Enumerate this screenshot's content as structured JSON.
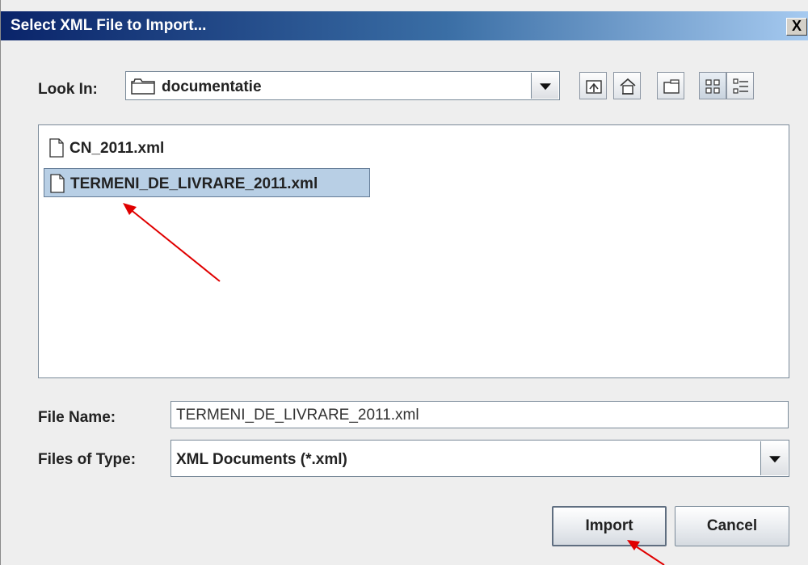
{
  "dialog": {
    "title": "Select XML File to Import...",
    "close_glyph": "X"
  },
  "look_in": {
    "label": "Look In:",
    "value": "documentatie"
  },
  "toolbar": {
    "icons": [
      "up-one-level-icon",
      "home-icon",
      "new-folder-icon",
      "list-view-icon",
      "details-view-icon"
    ]
  },
  "files": [
    {
      "name": "CN_2011.xml",
      "selected": false
    },
    {
      "name": "TERMENI_DE_LIVRARE_2011.xml",
      "selected": true
    }
  ],
  "file_name": {
    "label": "File Name:",
    "value": "TERMENI_DE_LIVRARE_2011.xml"
  },
  "files_of_type": {
    "label": "Files of Type:",
    "value": "XML Documents (*.xml)"
  },
  "buttons": {
    "import": "Import",
    "cancel": "Cancel"
  },
  "colors": {
    "title_bar": "#0a246a",
    "selection": "#b8cfe5",
    "annotation_arrow": "#e00000"
  }
}
